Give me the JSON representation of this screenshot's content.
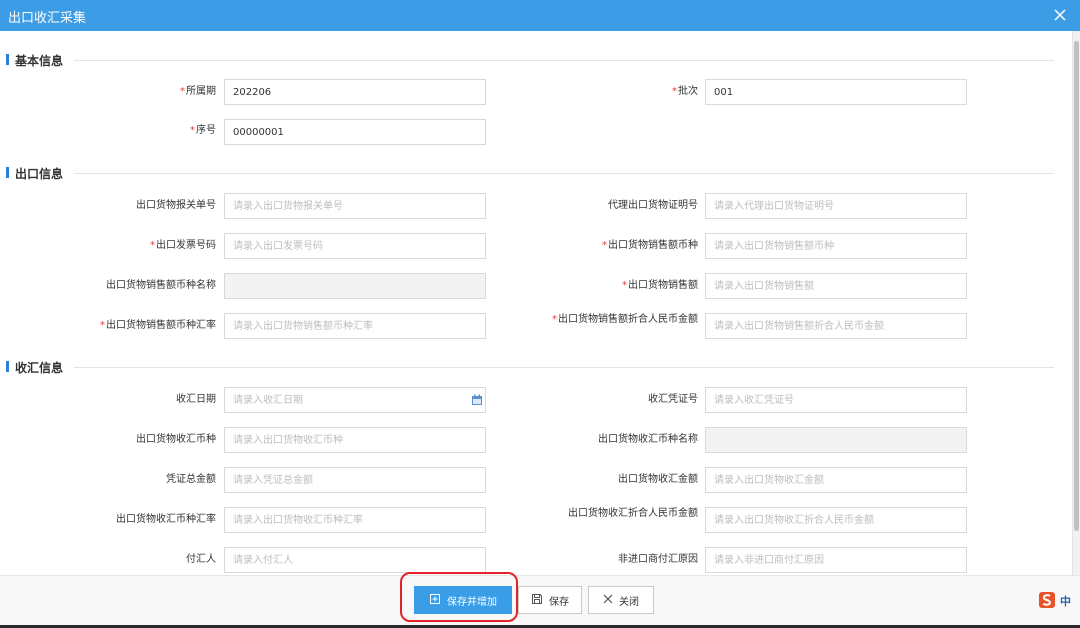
{
  "window": {
    "title": "出口收汇采集"
  },
  "sections": {
    "basic": "基本信息",
    "export": "出口信息",
    "receipt": "收汇信息"
  },
  "basic": {
    "period_label": "所属期",
    "period_value": "202206",
    "batch_label": "批次",
    "batch_value": "001",
    "seq_label": "序号",
    "seq_value": "00000001"
  },
  "export": {
    "customs_no_label": "出口货物报关单号",
    "customs_no_placeholder": "请录入出口货物报关单号",
    "agent_cert_label": "代理出口货物证明号",
    "agent_cert_placeholder": "请录入代理出口货物证明号",
    "invoice_no_label": "出口发票号码",
    "invoice_no_placeholder": "请录入出口发票号码",
    "sales_currency_label": "出口货物销售额币种",
    "sales_currency_placeholder": "请录入出口货物销售额币种",
    "currency_name_label": "出口货物销售额币种名称",
    "sales_amount_label": "出口货物销售额",
    "sales_amount_placeholder": "请录入出口货物销售额",
    "exchange_rate_label": "出口货物销售额币种汇率",
    "exchange_rate_placeholder": "请录入出口货物销售额币种汇率",
    "rmb_amount_label": "出口货物销售额折合人民币金额",
    "rmb_amount_placeholder": "请录入出口货物销售额折合人民币金额"
  },
  "receipt": {
    "date_label": "收汇日期",
    "date_placeholder": "请录入收汇日期",
    "voucher_label": "收汇凭证号",
    "voucher_placeholder": "请录入收汇凭证号",
    "currency_label": "出口货物收汇币种",
    "currency_placeholder": "请录入出口货物收汇币种",
    "currency_name_label": "出口货物收汇币种名称",
    "voucher_total_label": "凭证总金额",
    "voucher_total_placeholder": "请录入凭证总金额",
    "amount_label": "出口货物收汇金额",
    "amount_placeholder": "请录入出口货物收汇金额",
    "rate_label": "出口货物收汇币种汇率",
    "rate_placeholder": "请录入出口货物收汇币种汇率",
    "rmb_label": "出口货物收汇折合人民币金额",
    "rmb_placeholder": "请录入出口货物收汇折合人民币金额",
    "payer_label": "付汇人",
    "payer_placeholder": "请录入付汇人",
    "non_importer_label": "非进口商付汇原因",
    "non_importer_placeholder": "请录入非进口商付汇原因"
  },
  "footer": {
    "save_add_label": "保存并增加",
    "save_label": "保存",
    "close_label": "关闭"
  },
  "ime": {
    "label": "中"
  },
  "colors": {
    "titlebar": "#3d9ce6",
    "primary": "#3a9de8",
    "required": "#e23b3b",
    "highlight": "#e2242b"
  }
}
